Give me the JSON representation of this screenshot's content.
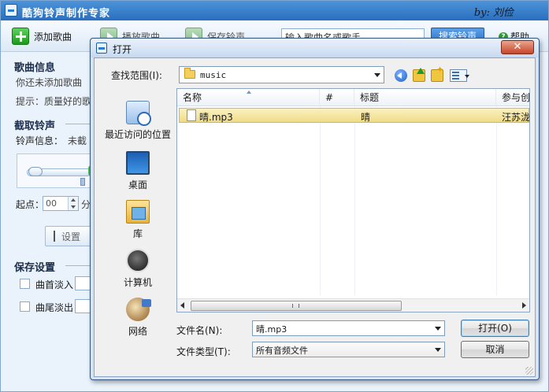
{
  "app": {
    "title": "酷狗铃声制作专家",
    "author": "by: 刘俭",
    "toolbar": {
      "add_song": "添加歌曲",
      "play_song": "播放歌曲",
      "save_ringtone": "保存铃声",
      "search_placeholder": "输入歌曲名或歌手",
      "search_button": "搜索铃声",
      "help": "帮助"
    },
    "sidebar": {
      "song_info_title": "歌曲信息",
      "no_song_text": "你还未添加歌曲",
      "tip_text": "提示：质量好的歌",
      "cut_title": "截取铃声",
      "ringtone_info_label": "铃声信息：",
      "ringtone_info_value": "未截",
      "start_label": "起点：",
      "start_value": "00",
      "minute_label": "分",
      "set_button": "设置",
      "save_title": "保存设置",
      "fade_in": "曲首淡入",
      "fade_out": "曲尾淡出"
    }
  },
  "dialog": {
    "title": "打开",
    "close_label": "✕",
    "lookin_label": "查找范围(I):",
    "lookin_value": "music",
    "places": [
      {
        "label": "最近访问的位置",
        "icon": "recent-places-icon"
      },
      {
        "label": "桌面",
        "icon": "desktop-icon"
      },
      {
        "label": "库",
        "icon": "libraries-icon"
      },
      {
        "label": "计算机",
        "icon": "computer-icon"
      },
      {
        "label": "网络",
        "icon": "network-icon"
      }
    ],
    "columns": [
      "名称",
      "#",
      "标题",
      "参与创作"
    ],
    "files": [
      {
        "name": "晴.mp3",
        "track": "",
        "title": "晴",
        "artist": "汪苏泷"
      }
    ],
    "scroll_thumb_label": "III",
    "filename_label": "文件名(N):",
    "filename_value": "晴.mp3",
    "filetype_label": "文件类型(T):",
    "filetype_value": "所有音频文件",
    "open_button": "打开(O)",
    "cancel_button": "取消"
  }
}
